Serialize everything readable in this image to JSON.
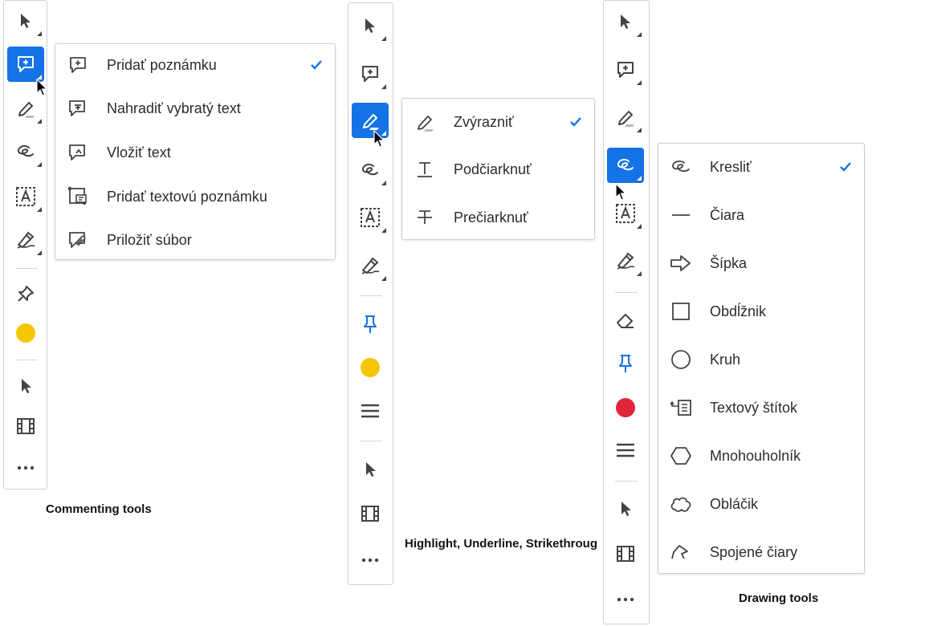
{
  "captions": {
    "commenting": "Commenting tools",
    "highlight": "Highlight, Underline, Strikethroug",
    "drawing": "Drawing tools"
  },
  "colors": {
    "accent": "#1473e6",
    "yellow": "#f6c700",
    "red": "#e0263b",
    "pin_blue": "#1473e6"
  },
  "toolbar_icons": [
    "select-arrow-icon",
    "add-comment-icon",
    "highlighter-icon",
    "freehand-icon",
    "text-box-icon",
    "signature-icon",
    "pin-icon",
    "color-swatch",
    "line-weight-icon",
    "pointer-icon",
    "film-icon",
    "more-icon"
  ],
  "menu1": {
    "items": [
      {
        "label": "Pridať poznámku",
        "icon": "add-comment-icon",
        "checked": true
      },
      {
        "label": "Nahradiť vybratý text",
        "icon": "replace-text-icon",
        "checked": false
      },
      {
        "label": "Vložiť text",
        "icon": "insert-text-icon",
        "checked": false
      },
      {
        "label": "Pridať textovú poznámku",
        "icon": "text-note-icon",
        "checked": false
      },
      {
        "label": "Priložiť súbor",
        "icon": "attach-file-icon",
        "checked": false
      }
    ]
  },
  "menu2": {
    "items": [
      {
        "label": "Zvýrazniť",
        "icon": "highlighter-icon",
        "checked": true
      },
      {
        "label": "Podčiarknuť",
        "icon": "underline-icon",
        "checked": false
      },
      {
        "label": "Prečiarknuť",
        "icon": "strikethrough-icon",
        "checked": false
      }
    ]
  },
  "menu3": {
    "items": [
      {
        "label": "Kresliť",
        "icon": "freehand-icon",
        "checked": true
      },
      {
        "label": "Čiara",
        "icon": "line-icon",
        "checked": false
      },
      {
        "label": "Šípka",
        "icon": "arrow-icon",
        "checked": false
      },
      {
        "label": "Obdĺžnik",
        "icon": "rectangle-icon",
        "checked": false
      },
      {
        "label": "Kruh",
        "icon": "circle-icon",
        "checked": false
      },
      {
        "label": "Textový štítok",
        "icon": "text-callout-icon",
        "checked": false
      },
      {
        "label": "Mnohouholník",
        "icon": "polygon-icon",
        "checked": false
      },
      {
        "label": "Obláčik",
        "icon": "cloud-icon",
        "checked": false
      },
      {
        "label": "Spojené čiary",
        "icon": "polyline-icon",
        "checked": false
      }
    ]
  }
}
